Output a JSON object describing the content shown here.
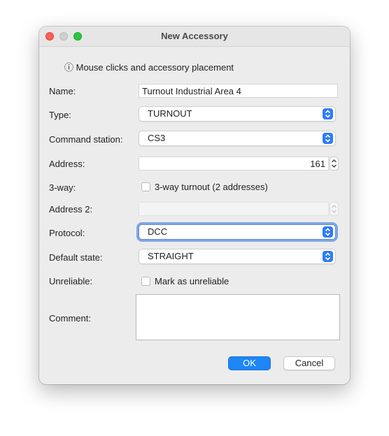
{
  "window": {
    "title": "New Accessory"
  },
  "info": {
    "icon": "info-icon",
    "text": "ⓘ Mouse clicks and accessory placement"
  },
  "form": {
    "name": {
      "label": "Name:",
      "value": "Turnout Industrial Area 4"
    },
    "type": {
      "label": "Type:",
      "value": "TURNOUT"
    },
    "command_station": {
      "label": "Command station:",
      "value": "CS3"
    },
    "address": {
      "label": "Address:",
      "value": "161"
    },
    "three_way": {
      "label": "3-way:",
      "checkbox_label": "3-way turnout (2 addresses)",
      "checked": false
    },
    "address2": {
      "label": "Address 2:",
      "value": ""
    },
    "protocol": {
      "label": "Protocol:",
      "value": "DCC"
    },
    "default_state": {
      "label": "Default state:",
      "value": "STRAIGHT"
    },
    "unreliable": {
      "label": "Unreliable:",
      "checkbox_label": "Mark as unreliable",
      "checked": false
    },
    "comment": {
      "label": "Comment:",
      "value": ""
    }
  },
  "buttons": {
    "ok": "OK",
    "cancel": "Cancel"
  },
  "colors": {
    "accent": "#1e86f5",
    "close": "#fe5f57",
    "maximize": "#28c840"
  }
}
